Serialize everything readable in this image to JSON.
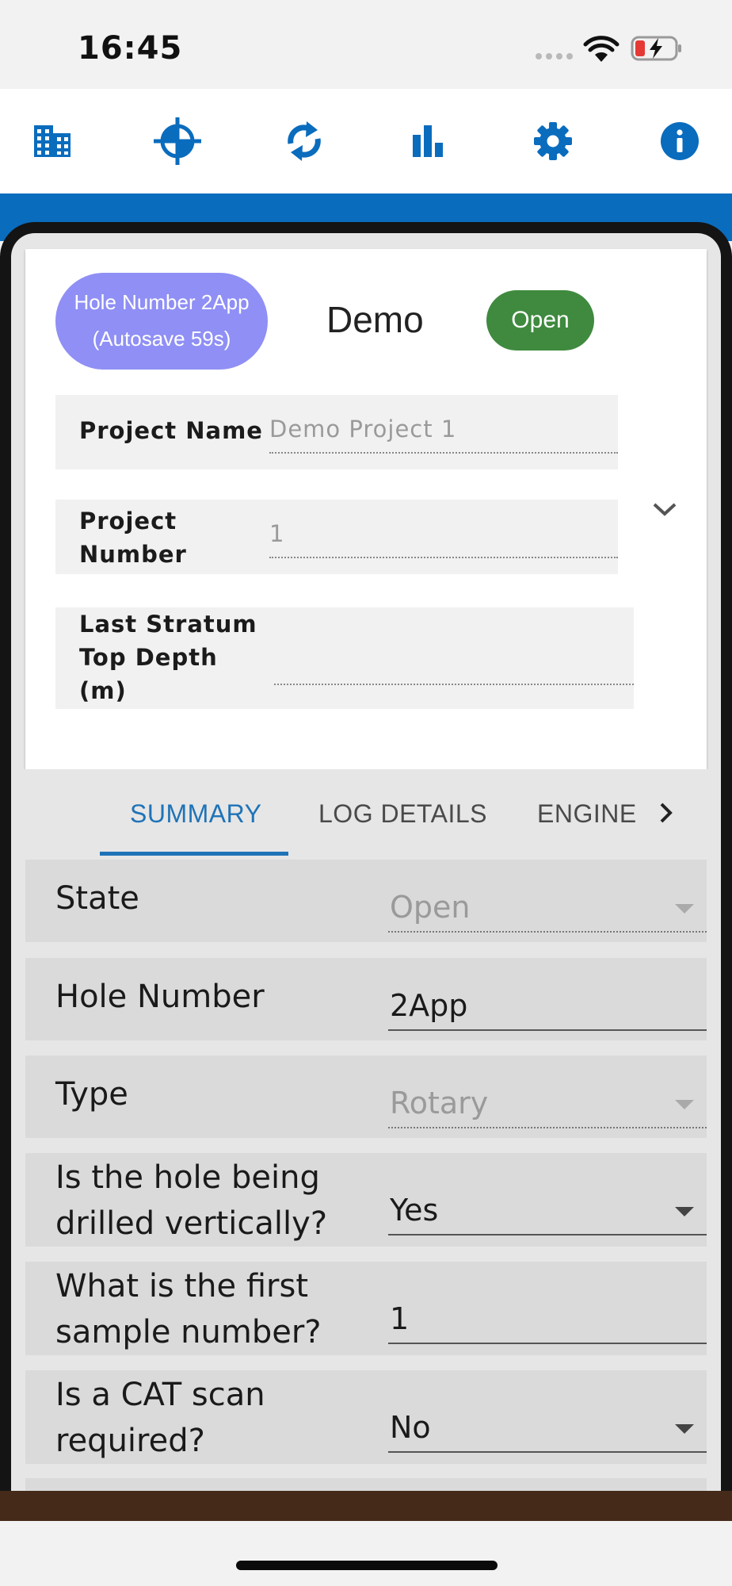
{
  "status_bar": {
    "time": "16:45"
  },
  "toolbar": {
    "icons": [
      "building-icon",
      "crosshair-icon",
      "sync-icon",
      "bar-chart-icon",
      "gear-icon",
      "info-icon"
    ],
    "accent": "#0a6cbd"
  },
  "header": {
    "hole_pill_line1": "Hole Number 2App",
    "hole_pill_line2": "(Autosave 59s)",
    "title": "Demo",
    "status": "Open",
    "fields": [
      {
        "label_lines": [
          "Project Name"
        ],
        "value": "Demo Project 1"
      },
      {
        "label_lines": [
          "Project",
          "Number"
        ],
        "value": "1"
      },
      {
        "label_lines": [
          "Last Stratum",
          "Top Depth",
          "(m)"
        ],
        "value": ""
      }
    ]
  },
  "tabs": {
    "items": [
      "SUMMARY",
      "LOG DETAILS",
      "ENGINE"
    ],
    "active": "SUMMARY"
  },
  "form": {
    "rows": [
      {
        "label_lines": [
          "State"
        ],
        "value": "Open",
        "control": "select",
        "disabled": true
      },
      {
        "label_lines": [
          "Hole Number"
        ],
        "value": "2App",
        "control": "text",
        "disabled": false
      },
      {
        "label_lines": [
          "Type"
        ],
        "value": "Rotary",
        "control": "select",
        "disabled": true
      },
      {
        "label_lines": [
          "Is the hole being",
          "drilled vertically?"
        ],
        "value": "Yes",
        "control": "select",
        "disabled": false
      },
      {
        "label_lines": [
          "What is the first",
          "sample number?"
        ],
        "value": "1",
        "control": "text",
        "disabled": false
      },
      {
        "label_lines": [
          "Is a CAT scan",
          "required?"
        ],
        "value": "No",
        "control": "select",
        "disabled": false
      }
    ]
  },
  "colors": {
    "hole_pill": "#8f8ff5",
    "open_badge": "#3f8a3f",
    "tab_active": "#1f73b7",
    "bottom_bar": "#452a1a"
  }
}
